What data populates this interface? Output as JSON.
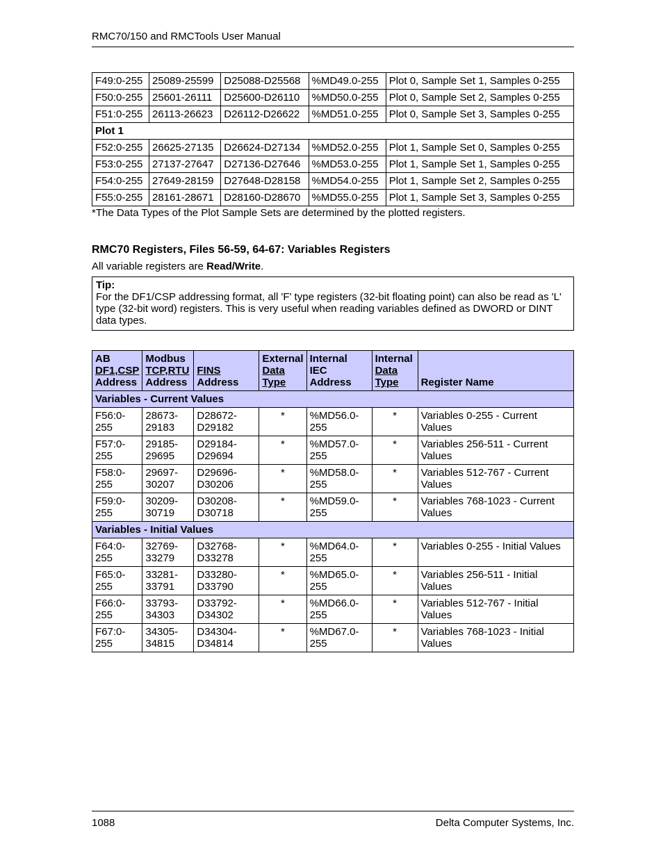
{
  "header": "RMC70/150 and RMCTools User Manual",
  "table1": {
    "rows": [
      [
        "F49:0-255",
        "25089-25599",
        "D25088-D25568",
        "%MD49.0-255",
        "Plot 0, Sample Set 1, Samples 0-255"
      ],
      [
        "F50:0-255",
        "25601-26111",
        "D25600-D26110",
        "%MD50.0-255",
        "Plot 0, Sample Set 2, Samples 0-255"
      ],
      [
        "F51:0-255",
        "26113-26623",
        "D26112-D26622",
        "%MD51.0-255",
        "Plot 0, Sample Set 3, Samples 0-255"
      ]
    ],
    "section": "Plot 1",
    "rows2": [
      [
        "F52:0-255",
        "26625-27135",
        "D26624-D27134",
        "%MD52.0-255",
        "Plot 1, Sample Set 0, Samples 0-255"
      ],
      [
        "F53:0-255",
        "27137-27647",
        "D27136-D27646",
        "%MD53.0-255",
        "Plot 1, Sample Set 1, Samples 0-255"
      ],
      [
        "F54:0-255",
        "27649-28159",
        "D27648-D28158",
        "%MD54.0-255",
        "Plot 1, Sample Set 2, Samples 0-255"
      ],
      [
        "F55:0-255",
        "28161-28671",
        "D28160-D28670",
        "%MD55.0-255",
        "Plot 1, Sample Set 3, Samples 0-255"
      ]
    ]
  },
  "footnote": "*The Data Types of the Plot Sample Sets are determined by the plotted registers.",
  "heading2": "RMC70 Registers, Files 56-59, 64-67: Variables Registers",
  "para_prefix": "All variable registers are ",
  "para_bold": "Read/Write",
  "para_suffix": ".",
  "tip_label": "Tip:",
  "tip_body": "For the DF1/CSP addressing format, all 'F' type registers (32-bit floating point) can also be read as 'L' type (32-bit word) registers. This is very useful when reading variables defined as DWORD or DINT data types.",
  "table2": {
    "hdr": {
      "ab_top": "AB",
      "ab_link": "DF1,CSP",
      "ab_bot": "Address",
      "mod_top": "Modbus",
      "mod_link": "TCP,RTU",
      "mod_bot": "Address",
      "fins_link": "FINS",
      "fins_bot": "Address",
      "ext_top": "External",
      "ext_link": "Data",
      "ext_link2": "Type",
      "iec_top": "Internal",
      "iec_bold": "IEC",
      "iec_bold2": "Address",
      "int_top": "Internal",
      "int_link": "Data",
      "int_link2": "Type",
      "name": "Register Name"
    },
    "sub1": "Variables - Current Values",
    "rows1": [
      [
        "F56:0-255",
        "28673-29183",
        "D28672-D29182",
        "*",
        "%MD56.0-255",
        "*",
        "Variables 0-255 - Current Values"
      ],
      [
        "F57:0-255",
        "29185-29695",
        "D29184-D29694",
        "*",
        "%MD57.0-255",
        "*",
        "Variables 256-511 - Current Values"
      ],
      [
        "F58:0-255",
        "29697-30207",
        "D29696-D30206",
        "*",
        "%MD58.0-255",
        "*",
        "Variables 512-767 - Current Values"
      ],
      [
        "F59:0-255",
        "30209-30719",
        "D30208-D30718",
        "*",
        "%MD59.0-255",
        "*",
        "Variables 768-1023 - Current Values"
      ]
    ],
    "sub2": "Variables - Initial Values",
    "rows2": [
      [
        "F64:0-255",
        "32769-33279",
        "D32768-D33278",
        "*",
        "%MD64.0-255",
        "*",
        "Variables 0-255 - Initial Values"
      ],
      [
        "F65:0-255",
        "33281-33791",
        "D33280-D33790",
        "*",
        "%MD65.0-255",
        "*",
        "Variables 256-511 - Initial Values"
      ],
      [
        "F66:0-255",
        "33793-34303",
        "D33792-D34302",
        "*",
        "%MD66.0-255",
        "*",
        "Variables 512-767 - Initial Values"
      ],
      [
        "F67:0-255",
        "34305-34815",
        "D34304-D34814",
        "*",
        "%MD67.0-255",
        "*",
        "Variables 768-1023 - Initial Values"
      ]
    ]
  },
  "footer_left": "1088",
  "footer_right": "Delta Computer Systems, Inc."
}
